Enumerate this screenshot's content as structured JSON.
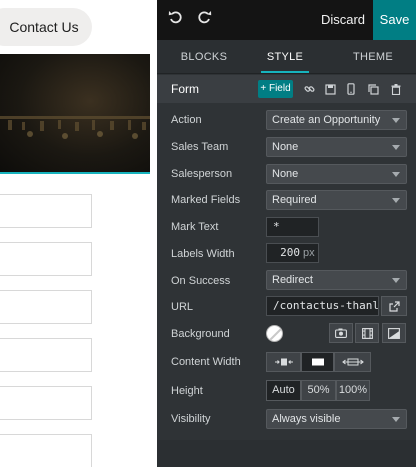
{
  "preview": {
    "contact_button": "Contact Us"
  },
  "topbar": {
    "undo_icon": "undo-icon",
    "redo_icon": "redo-icon",
    "discard_label": "Discard",
    "save_label": "Save",
    "save_color": "#017e84"
  },
  "tabs": [
    {
      "label": "BLOCKS",
      "active": false
    },
    {
      "label": "STYLE",
      "active": true
    },
    {
      "label": "THEME",
      "active": false
    }
  ],
  "section": {
    "title": "Form",
    "add_field_label": "+ Field",
    "icons": [
      "link-icon",
      "save-disk-icon",
      "mobile-icon",
      "clone-icon",
      "trash-icon"
    ]
  },
  "options": {
    "action": {
      "label": "Action",
      "value": "Create an Opportunity"
    },
    "sales_team": {
      "label": "Sales Team",
      "value": "None"
    },
    "salesperson": {
      "label": "Salesperson",
      "value": "None"
    },
    "marked_fields": {
      "label": "Marked Fields",
      "value": "Required"
    },
    "mark_text": {
      "label": "Mark Text",
      "value": "*"
    },
    "labels_width": {
      "label": "Labels Width",
      "value": "200",
      "unit": "px"
    },
    "on_success": {
      "label": "On Success",
      "value": "Redirect"
    },
    "url": {
      "label": "URL",
      "value": "/contactus-thanl"
    },
    "background": {
      "label": "Background",
      "color": "#ffffff"
    },
    "content_width": {
      "label": "Content Width"
    },
    "height": {
      "label": "Height",
      "choices": [
        "Auto",
        "50%",
        "100%"
      ],
      "selected": "Auto"
    },
    "visibility": {
      "label": "Visibility",
      "value": "Always visible"
    }
  },
  "accent_color": "#17b3bd"
}
